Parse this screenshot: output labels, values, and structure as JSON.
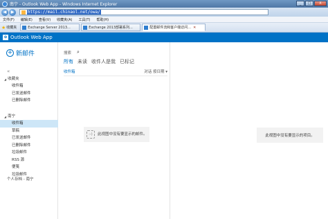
{
  "browser": {
    "title": "南宁 - Outlook Web App - Windows Internet Explorer",
    "window_buttons": [
      "_",
      "□",
      "X"
    ],
    "url_highlight": "https://mail.chinaol.net/owa/",
    "menu": [
      "文件(F)",
      "编辑(E)",
      "查看(V)",
      "收藏夹(A)",
      "工具(T)",
      "帮助(H)"
    ],
    "favorites_label": "收藏夹",
    "tabs": [
      {
        "label": "Exchange Server 2013...",
        "active": false
      },
      {
        "label": "Exchange 2013部署系列...",
        "active": false
      },
      {
        "label": "配置邮件流和客户端访问...",
        "active": true
      }
    ]
  },
  "owa": {
    "brand": "Outlook Web App",
    "new_mail": "新邮件",
    "favorites_section": {
      "header": "收藏夹",
      "items": [
        "收件箱",
        "已发送邮件",
        "已删除邮件"
      ]
    },
    "mailbox_section": {
      "header": "南宁",
      "items": [
        "收件箱",
        "草稿",
        "已发送邮件",
        "已删除邮件",
        "垃圾邮件",
        "RSS 源",
        "便笺",
        "垃圾邮件"
      ],
      "selected_index": 0
    },
    "footer_link": "个人存档 - 南宁",
    "search_label": "搜索",
    "filters": [
      "所有",
      "未读",
      "收件人是我",
      "已标记"
    ],
    "list_folder": "收件箱",
    "sort_label": "对话 按日期 ▾",
    "empty_list_message": "此视图中没有要显示的邮件。",
    "empty_reading_message": "此视图中没有要显示的项目。"
  },
  "colors": {
    "brand_blue": "#0072c6",
    "selected_bg": "#cde6f7"
  }
}
